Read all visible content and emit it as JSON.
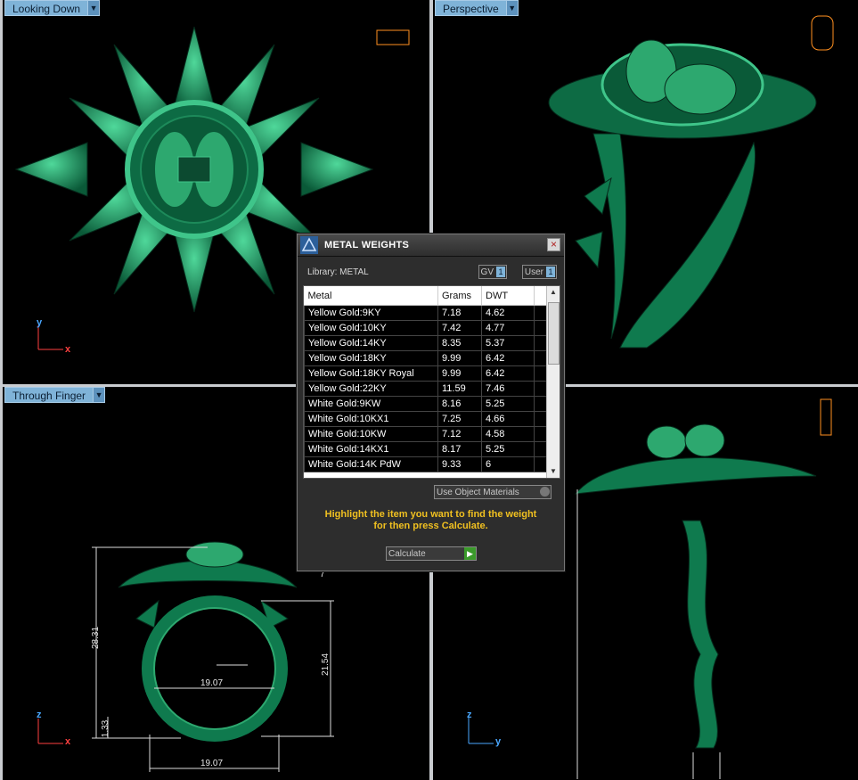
{
  "viewports": {
    "top_left": {
      "label": "Looking Down",
      "axis_v": "y",
      "axis_h": "x"
    },
    "top_right": {
      "label": "Perspective"
    },
    "bottom_left": {
      "label": "Through Finger",
      "axis_v": "z",
      "axis_h": "x",
      "dims": {
        "height": "28.31",
        "inner": "21.54",
        "width_top": "19.07",
        "width_bottom": "19.07",
        "shank": "1.33",
        "top_small": "7"
      }
    },
    "bottom_right": {
      "axis_v": "z",
      "axis_h": "y"
    }
  },
  "dialog": {
    "title": "METAL WEIGHTS",
    "library_label": "Library: METAL",
    "gv_label": "GV",
    "gv_value": "1",
    "user_label": "User",
    "user_value": "1",
    "columns": [
      "Metal",
      "Grams",
      "DWT"
    ],
    "rows": [
      {
        "metal": "Yellow Gold:9KY",
        "grams": "7.18",
        "dwt": "4.62"
      },
      {
        "metal": "Yellow Gold:10KY",
        "grams": "7.42",
        "dwt": "4.77"
      },
      {
        "metal": "Yellow Gold:14KY",
        "grams": "8.35",
        "dwt": "5.37"
      },
      {
        "metal": "Yellow Gold:18KY",
        "grams": "9.99",
        "dwt": "6.42"
      },
      {
        "metal": "Yellow Gold:18KY Royal",
        "grams": "9.99",
        "dwt": "6.42"
      },
      {
        "metal": "Yellow Gold:22KY",
        "grams": "11.59",
        "dwt": "7.46"
      },
      {
        "metal": "White Gold:9KW",
        "grams": "8.16",
        "dwt": "5.25"
      },
      {
        "metal": "White Gold:10KX1",
        "grams": "7.25",
        "dwt": "4.66"
      },
      {
        "metal": "White Gold:10KW",
        "grams": "7.12",
        "dwt": "4.58"
      },
      {
        "metal": "White Gold:14KX1",
        "grams": "8.17",
        "dwt": "5.25"
      },
      {
        "metal": "White Gold:14K PdW",
        "grams": "9.33",
        "dwt": "6"
      }
    ],
    "use_object_materials": "Use Object Materials",
    "instruction_line1": "Highlight the item you want to find the weight",
    "instruction_line2": "for then press Calculate.",
    "calculate_label": "Calculate",
    "colors": {
      "model": "#0f7a4e",
      "model_light": "#3fc58a",
      "highlight": "#f0c020",
      "label_bg": "#7fb3d8"
    }
  }
}
